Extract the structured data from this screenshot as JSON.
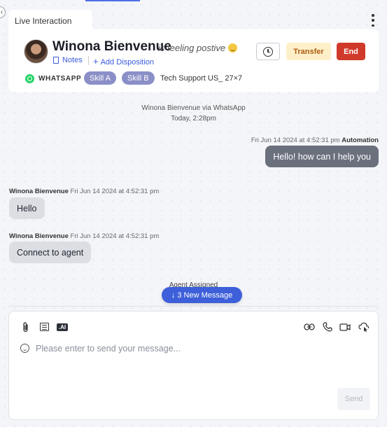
{
  "tab": {
    "label": "Live Interaction"
  },
  "customer": {
    "name": "Winona Bienvenue",
    "sentiment": "is feeling postive",
    "notes_label": "Notes",
    "add_disposition_label": "Add Disposition",
    "channel": "WHATSAPP",
    "skills": [
      "Skill A",
      "Skill B"
    ],
    "queue": "Tech Support US_ 27×7"
  },
  "actions": {
    "transfer_label": "Transfer",
    "end_label": "End"
  },
  "colors": {
    "accent": "#3d5fd9",
    "transfer_bg": "#fdf0c9",
    "end_bg": "#d03a2a",
    "skill_bg": "#8b8fc7",
    "whatsapp": "#25d366"
  },
  "conversation": {
    "header_line": "Winona Bienvenue via WhatsApp",
    "header_time": "Today, 2:28pm",
    "messages": [
      {
        "direction": "outgoing",
        "timestamp": "Fri Jun 14 2024 at 4:52:31 pm",
        "sender": "Automation",
        "text": "Hello! how can I help you"
      },
      {
        "direction": "incoming",
        "sender": "Winona Bienvenue",
        "timestamp": "Fri Jun 14 2024 at 4:52:31 pm",
        "text": "Hello"
      },
      {
        "direction": "incoming",
        "sender": "Winona Bienvenue",
        "timestamp": "Fri Jun 14 2024 at 4:52:31 pm",
        "text": "Connect to agent"
      }
    ],
    "system_event": "Agent Assigned",
    "new_messages_label": "↓ 3 New Message"
  },
  "composer": {
    "placeholder": "Please enter to send your message...",
    "send_label": "Send",
    "ai_label": ".AI",
    "icons": [
      "attachment-icon",
      "template-icon",
      "ai-icon",
      "link-icon",
      "phone-icon",
      "video-icon",
      "cobrowse-icon",
      "emoji-icon"
    ]
  }
}
